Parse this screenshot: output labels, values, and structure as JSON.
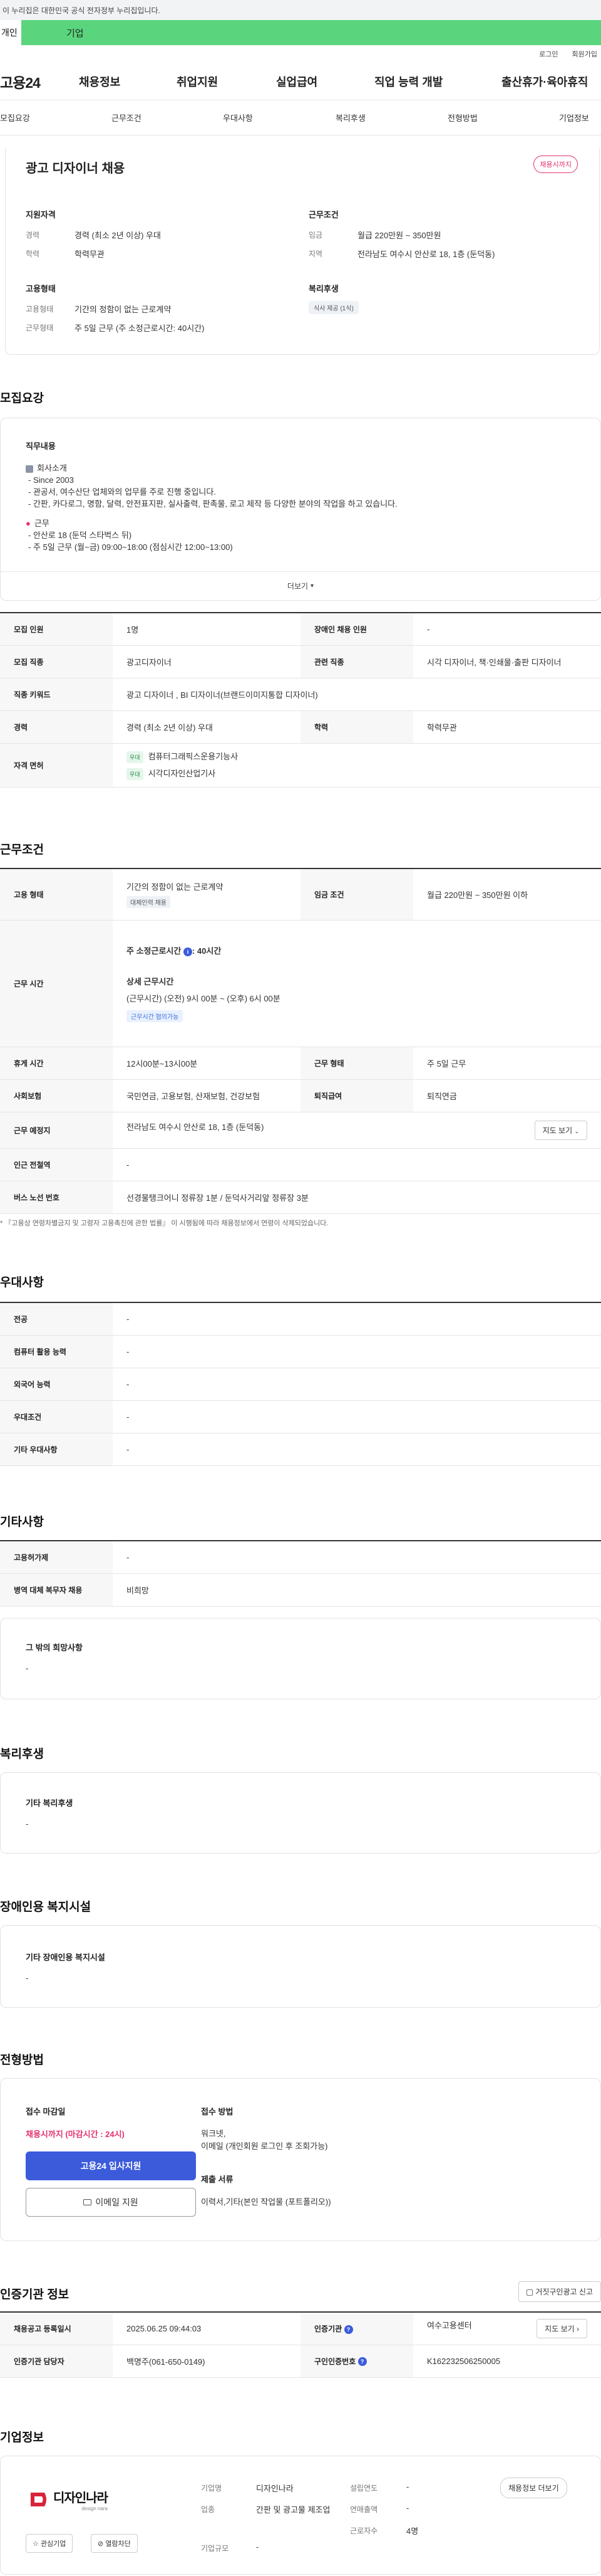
{
  "gov_notice": "이 누리집은 대한민국 공식 전자정부 누리집입니다.",
  "member_tabs": {
    "individual": "개인",
    "business": "기업"
  },
  "top_links": {
    "login": "로그인",
    "join": "회원가입"
  },
  "logo": "고용24",
  "gnb": [
    "채용정보",
    "취업지원",
    "실업급여",
    "직업 능력 개발",
    "출산휴가·육아휴직"
  ],
  "subnav": [
    "모집요강",
    "근무조건",
    "우대사항",
    "복리후생",
    "전형방법",
    "기업정보"
  ],
  "summary": {
    "title": "광고 디자이너 채용",
    "status_badge": "채용시까지",
    "qual_title": "지원자격",
    "career_label": "경력",
    "career_value": "경력 (최소 2년 이상) 우대",
    "edu_label": "학력",
    "edu_value": "학력무관",
    "cond_title": "근무조건",
    "wage_label": "임금",
    "wage_value": "월급 220만원 ~ 350만원",
    "region_label": "지역",
    "region_value": "전라남도 여수시 안산로 18, 1층 (둔덕동)",
    "emp_title": "고용형태",
    "emptype_label": "고용형태",
    "emptype_value": "기간의 정함이 없는 근로계약",
    "worktype_label": "근무형태",
    "worktype_value": "주 5일 근무 (주 소정근로시간: 40시간)",
    "welfare_title": "복리후생",
    "welfare_chip": "식사 제공 (1식)"
  },
  "recruit": {
    "section_title": "모집요강",
    "job_title": "직무내용",
    "company_intro_head": "회사소개",
    "lines": [
      "- Since 2003",
      "- 관공서, 여수산단 업체와의 업무를 주로 진행 중입니다.",
      "- 간판, 카다로그, 명함, 달력, 안전표지판, 실사출력, 판촉물, 로고 제작 등 다양한 분야의 작업을 하고 있습니다."
    ],
    "work_head": "근무",
    "work_lines": [
      "- 안산로 18 (둔덕 스타벅스 뒤)",
      "- 주 5일 근무 (월~금) 09:00~18:00 (점심시간 12:00~13:00)"
    ],
    "more": "더보기",
    "rows": {
      "headcount_label": "모집 인원",
      "headcount": "1명",
      "disabled_label": "장애인 채용 인원",
      "disabled": "-",
      "job_label": "모집 직종",
      "job": "광고디자이너",
      "related_label": "관련 직종",
      "related": "시각 디자이너, 책·인쇄물·출판 디자이너",
      "keyword_label": "직종 키워드",
      "keyword": "광고 디자이너 , BI 디자이너(브랜드이미지통합 디자이너)",
      "career_label": "경력",
      "career": "경력 (최소 2년 이상) 우대",
      "edu_label": "학력",
      "edu": "학력무관",
      "license_label": "자격 면허",
      "license_tag": "우대",
      "licenses": [
        "컴퓨터그래픽스운용기능사",
        "시각디자인산업기사"
      ]
    }
  },
  "conditions": {
    "section_title": "근무조건",
    "emptype_label": "고용 형태",
    "emptype": "기간의 정함이 없는 근로계약",
    "emptype_chip": "대체인력 채용",
    "wage_label": "임금 조건",
    "wage": "월급 220만원 ~ 350만원 이하",
    "hours_label": "근무 시간",
    "weekly_hours": "주 소정근로시간",
    "weekly_hours_val": ": 40시간",
    "detail_head": "상세 근무시간",
    "detail_val": "(근무시간) (오전) 9시 00분 ~ (오후) 6시 00분",
    "detail_chip": "근무시간 협의가능",
    "break_label": "휴게 시간",
    "break": "12시00분~13시00분",
    "worktype_label": "근무 형태",
    "worktype": "주 5일 근무",
    "insurance_label": "사회보험",
    "insurance": "국민연금, 고용보험, 산재보험, 건강보험",
    "severance_label": "퇴직급여",
    "severance": "퇴직연금",
    "place_label": "근무 예정지",
    "place": "전라남도 여수시 안산로 18, 1층 (둔덕동)",
    "map_button": "지도 보기",
    "station_label": "인근 전철역",
    "station": "-",
    "bus_label": "버스 노선 번호",
    "bus": "선경물탱크어니 정류장 1분 / 둔덕사거리앞 정류장 3분",
    "footnote": "* 『고용상 연령차별금지 및 고령자 고용촉진에 관한 법률』 이 시행됨에 따라 채용정보에서 연령이 삭제되었습니다."
  },
  "preference": {
    "section_title": "우대사항",
    "rows": [
      {
        "label": "전공",
        "value": "-"
      },
      {
        "label": "컴퓨터 활용 능력",
        "value": "-"
      },
      {
        "label": "외국어 능력",
        "value": "-"
      },
      {
        "label": "우대조건",
        "value": "-"
      },
      {
        "label": "기타 우대사항",
        "value": "-"
      }
    ]
  },
  "other": {
    "section_title": "기타사항",
    "rows": [
      {
        "label": "고용허가제",
        "value": "-"
      },
      {
        "label": "병역 대체 복무자 채용",
        "value": "비희망"
      }
    ],
    "extra_title": "그 밖의 희망사항",
    "extra_value": "-"
  },
  "welfare": {
    "section_title": "복리후생",
    "card_title": "기타 복리후생",
    "card_value": "-"
  },
  "disabled_fac": {
    "section_title": "장애인용 복지시설",
    "card_title": "기타 장애인용 복지시설",
    "card_value": "-"
  },
  "selection": {
    "section_title": "전형방법",
    "deadline_head": "접수 마감일",
    "deadline": "채용시까지 (마감시간 : 24시)",
    "apply_button": "고용24 입사지원",
    "email_button": "이메일 지원",
    "method_head": "접수 방법",
    "method_lines": [
      "워크넷,",
      "이메일 (개인회원 로그인 후 조회가능)"
    ],
    "docs_head": "제출 서류",
    "docs": "이력서,기타(본인 작업물 (포트폴리오))"
  },
  "certifier": {
    "section_title": "인증기관 정보",
    "report_button": "거짓구인광고 신고",
    "reg_label": "채용공고 등록일시",
    "reg": "2025.06.25 09:44:03",
    "org_label": "인증기관",
    "org": "여수고용센터",
    "map_button": "지도 보기",
    "manager_label": "인증기관 담당자",
    "manager": "백명주(061-650-0149)",
    "posting_label": "구인인증번호",
    "posting": "K162232506250005"
  },
  "company": {
    "section_title": "기업정보",
    "logo_text": "디자인나라",
    "logo_sub": "design nara",
    "fav_button": "관심기업",
    "block_button": "열람차단",
    "name_label": "기업명",
    "name": "디자인나라",
    "industry_label": "업종",
    "industry": "간판 및 광고물 제조업",
    "size_label": "기업규모",
    "size": "-",
    "founded_label": "설립연도",
    "founded": "-",
    "revenue_label": "연매출액",
    "revenue": "-",
    "employees_label": "근로자수",
    "employees": "4명",
    "jobs_button": "채용정보 더보기"
  }
}
